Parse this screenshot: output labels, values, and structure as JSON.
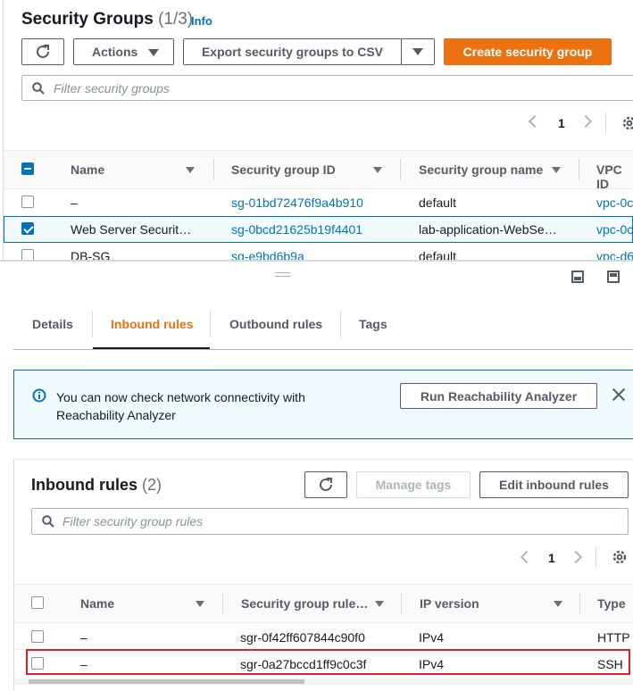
{
  "top": {
    "title": "Security Groups",
    "count": "(1/3)",
    "info": "Info",
    "actions_label": "Actions",
    "export_label": "Export security groups to CSV",
    "create_label": "Create security group",
    "search_placeholder": "Filter security groups",
    "page": "1",
    "columns": [
      "Name",
      "Security group ID",
      "Security group name",
      "VPC ID"
    ],
    "rows": [
      {
        "name": "–",
        "id": "sg-01bd72476f9a4b910",
        "group_name": "default",
        "vpc": "vpc-0c",
        "checked": false
      },
      {
        "name": "Web Server Securit…",
        "id": "sg-0bcd21625b19f4401",
        "group_name": "lab-application-WebSe…",
        "vpc": "vpc-0c",
        "checked": true
      },
      {
        "name": "DB-SG",
        "id": "sg-e9bd6b9a",
        "group_name": "default",
        "vpc": "vpc-d6",
        "checked": false
      }
    ]
  },
  "tabs": [
    "Details",
    "Inbound rules",
    "Outbound rules",
    "Tags"
  ],
  "active_tab": "Inbound rules",
  "banner": {
    "line1": "You can now check network connectivity with",
    "line2": "Reachability Analyzer",
    "button": "Run Reachability Analyzer"
  },
  "inbound": {
    "title": "Inbound rules",
    "count": "(2)",
    "manage_tags": "Manage tags",
    "edit_label": "Edit inbound rules",
    "search_placeholder": "Filter security group rules",
    "page": "1",
    "columns": [
      "Name",
      "Security group rule…",
      "IP version",
      "Type"
    ],
    "rows": [
      {
        "name": "–",
        "rule_id": "sgr-0f42ff607844c90f0",
        "ip": "IPv4",
        "type": "HTTP"
      },
      {
        "name": "–",
        "rule_id": "sgr-0a27bccd1ff9c0c3f",
        "ip": "IPv4",
        "type": "SSH"
      }
    ]
  },
  "colors": {
    "accent": "#ec7211",
    "link": "#0073bb",
    "highlight": "#e02020"
  }
}
